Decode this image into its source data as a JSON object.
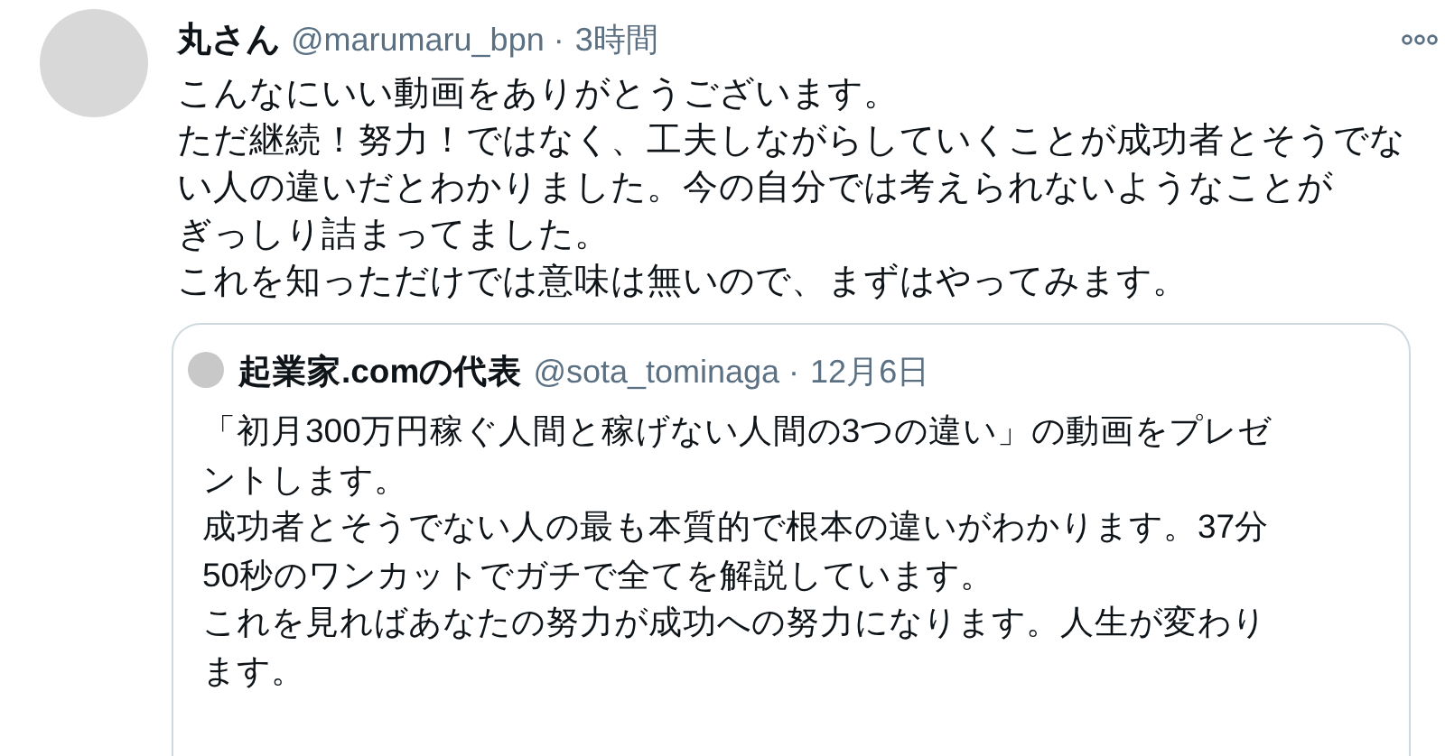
{
  "tweet": {
    "author": {
      "name": "丸さん",
      "handle": "@marumaru_bpn",
      "separator": "·",
      "time": "3時間"
    },
    "body": [
      "こんなにいい動画をありがとうございます。",
      "ただ継続！努力！ではなく、工夫しながらしていくことが成功者とそうでない人の違いだとわかりました。今の自分では考えられないようなことが",
      "ぎっしり詰まってました。",
      "これを知っただけでは意味は無いので、まずはやってみます。"
    ],
    "quoted_tweet": {
      "author": {
        "name": "起業家.comの代表",
        "handle": "@sota_tominaga",
        "separator": "·",
        "time": "12月6日"
      },
      "body": [
        "「初月300万円稼ぐ人間と稼げない人間の3つの違い」の動画をプレゼントします。",
        "成功者とそうでない人の最も本質的で根本の違いがわかります。37分50秒のワンカットでガチで全てを解説しています。",
        "これを見ればあなたの努力が成功への努力になります。人生が変わります。"
      ]
    }
  }
}
